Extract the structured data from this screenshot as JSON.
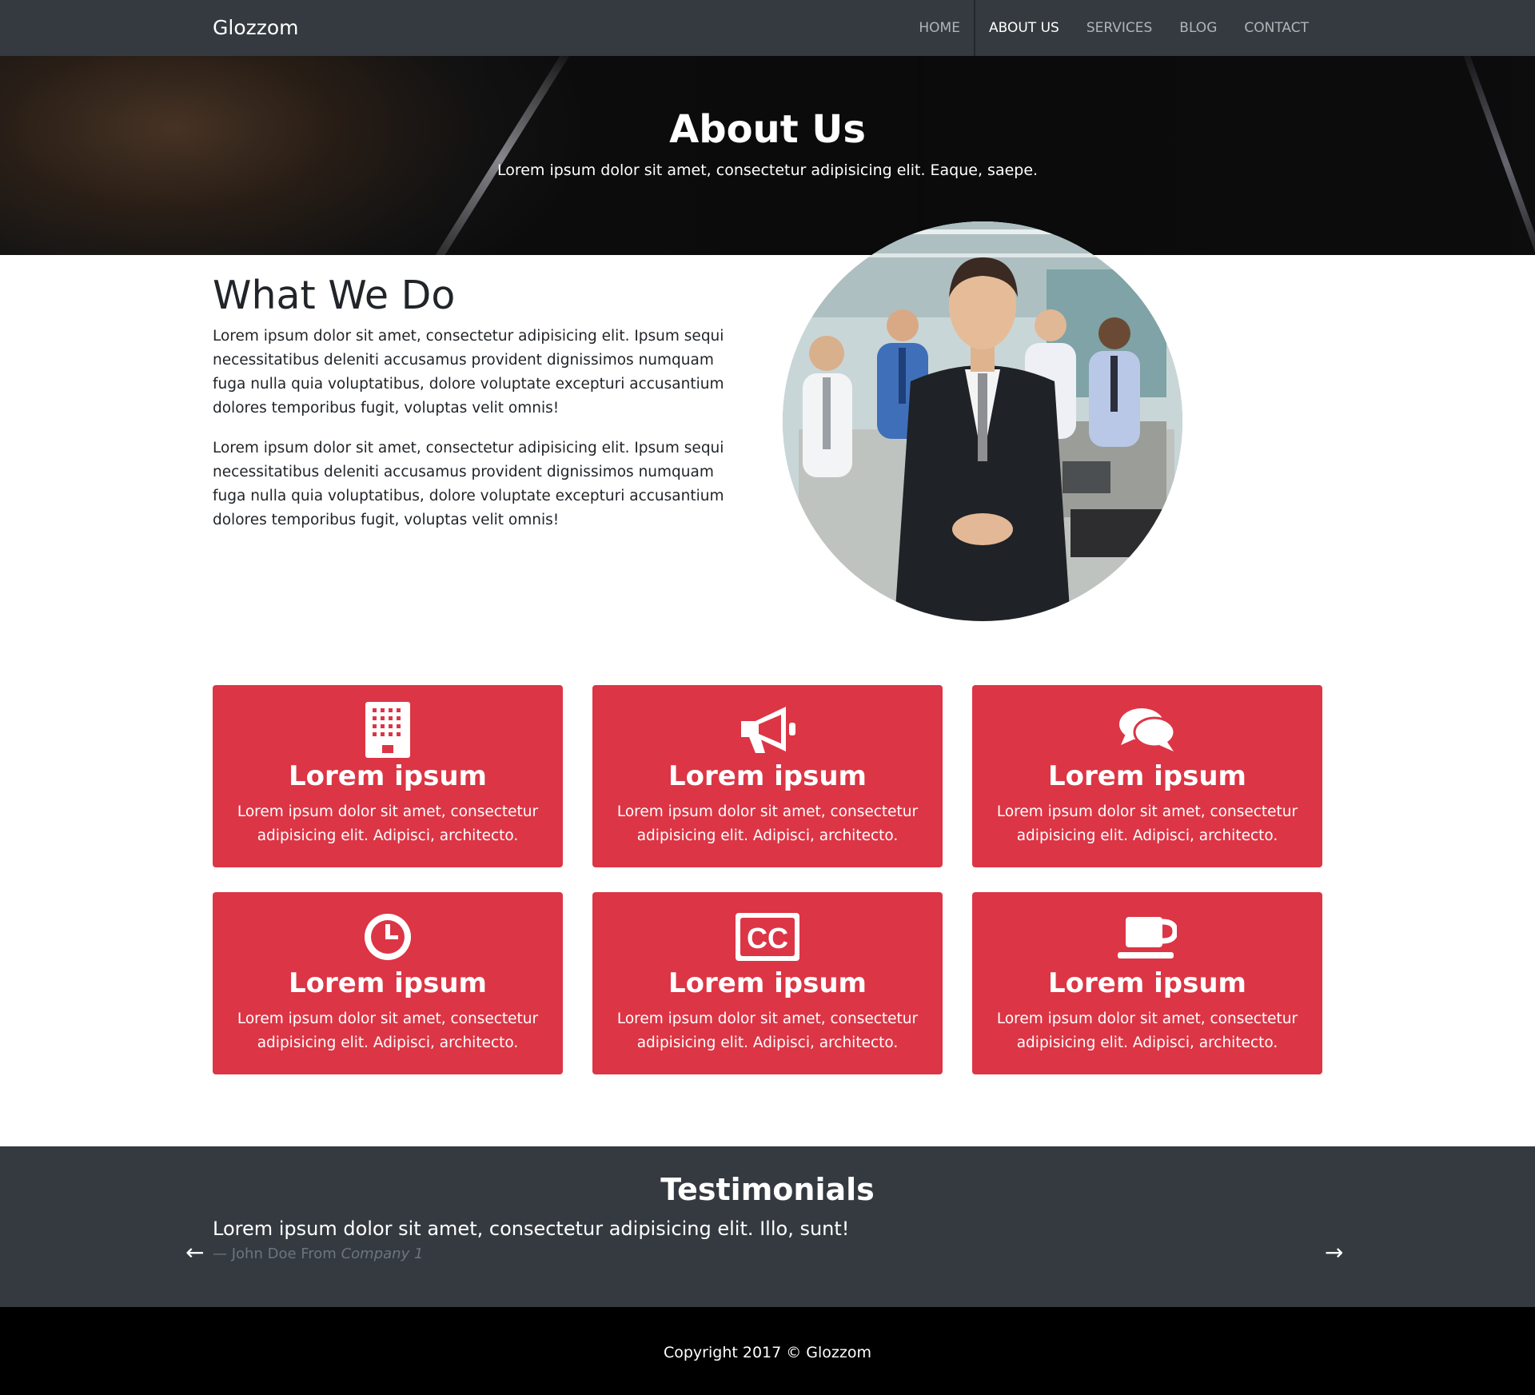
{
  "navbar": {
    "brand": "Glozzom",
    "items": [
      {
        "label": "HOME"
      },
      {
        "label": "ABOUT US"
      },
      {
        "label": "SERVICES"
      },
      {
        "label": "BLOG"
      },
      {
        "label": "CONTACT"
      }
    ],
    "active": "ABOUT US"
  },
  "hero": {
    "title": "About Us",
    "subtitle": "Lorem ipsum dolor sit amet, consectetur adipisicing elit. Eaque, saepe."
  },
  "what_we_do": {
    "title": "What We Do",
    "paragraphs": [
      "Lorem ipsum dolor sit amet, consectetur adipisicing elit. Ipsum sequi necessitatibus deleniti accusamus provident dignissimos numquam fuga nulla quia voluptatibus, dolore voluptate excepturi accusantium dolores temporibus fugit, voluptas velit omnis!",
      "Lorem ipsum dolor sit amet, consectetur adipisicing elit. Ipsum sequi necessitatibus deleniti accusamus provident dignissimos numquam fuga nulla quia voluptatibus, dolore voluptate excepturi accusantium dolores temporibus fugit, voluptas velit omnis!"
    ]
  },
  "services": {
    "card_color": "#dc3545",
    "cards": [
      {
        "icon": "building-icon",
        "title": "Lorem ipsum",
        "text": "Lorem ipsum dolor sit amet, consectetur adipisicing elit. Adipisci, architecto."
      },
      {
        "icon": "bullhorn-icon",
        "title": "Lorem ipsum",
        "text": "Lorem ipsum dolor sit amet, consectetur adipisicing elit. Adipisci, architecto."
      },
      {
        "icon": "comments-icon",
        "title": "Lorem ipsum",
        "text": "Lorem ipsum dolor sit amet, consectetur adipisicing elit. Adipisci, architecto."
      },
      {
        "icon": "clock-icon",
        "title": "Lorem ipsum",
        "text": "Lorem ipsum dolor sit amet, consectetur adipisicing elit. Adipisci, architecto."
      },
      {
        "icon": "closed-captioning-icon",
        "title": "Lorem ipsum",
        "text": "Lorem ipsum dolor sit amet, consectetur adipisicing elit. Adipisci, architecto."
      },
      {
        "icon": "coffee-icon",
        "title": "Lorem ipsum",
        "text": "Lorem ipsum dolor sit amet, consectetur adipisicing elit. Adipisci, architecto."
      }
    ]
  },
  "testimonials": {
    "title": "Testimonials",
    "quote": "Lorem ipsum dolor sit amet, consectetur adipisicing elit. Illo, sunt!",
    "author_prefix": "— John Doe From",
    "company": "Company 1",
    "prev_icon": "arrow-left-icon",
    "next_icon": "arrow-right-icon",
    "prev_glyph": "←",
    "next_glyph": "→"
  },
  "footer": {
    "copyright": "Copyright 2017 © Glozzom"
  }
}
